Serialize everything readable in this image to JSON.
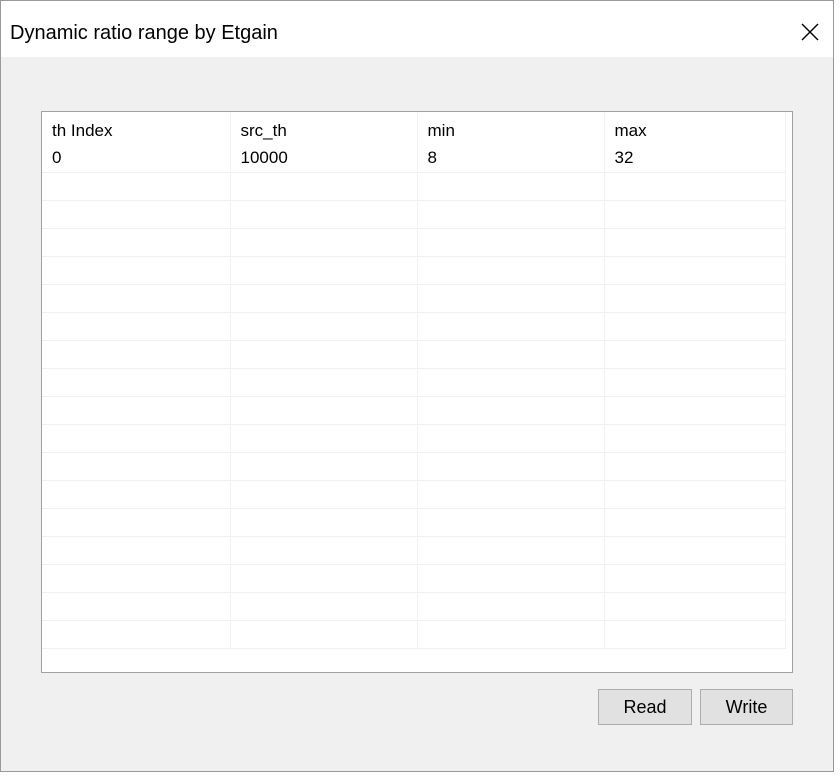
{
  "window": {
    "title": "Dynamic ratio range by Etgain"
  },
  "table": {
    "columns": [
      "th Index",
      "src_th",
      "min",
      "max"
    ],
    "rows": [
      [
        "0",
        "10000",
        "8",
        "32"
      ]
    ]
  },
  "buttons": {
    "read_label": "Read",
    "write_label": "Write"
  },
  "icons": {
    "close": "close-icon"
  },
  "colors": {
    "window_bg": "#f0f0f0",
    "grid_bg": "#ffffff",
    "button_bg": "#e1e1e1"
  }
}
